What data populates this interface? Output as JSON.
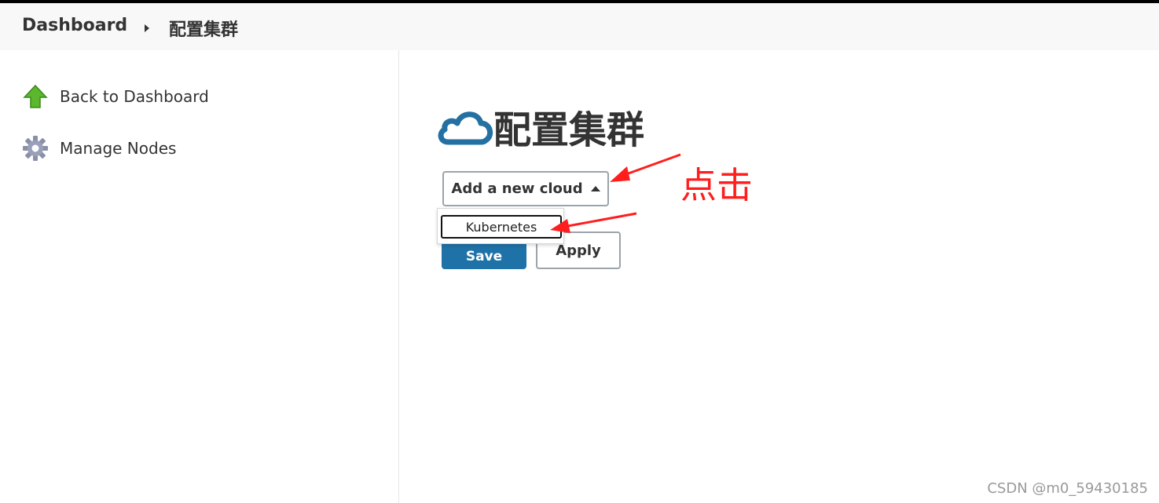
{
  "breadcrumb": {
    "root": "Dashboard",
    "current": "配置集群"
  },
  "sidebar": {
    "items": [
      {
        "label": "Back to Dashboard",
        "icon": "up-arrow-icon"
      },
      {
        "label": "Manage Nodes",
        "icon": "gear-icon"
      }
    ]
  },
  "main": {
    "title": "配置集群",
    "title_icon": "cloud-icon",
    "add_cloud_label": "Add a new cloud",
    "dropdown_options": [
      "Kubernetes"
    ],
    "save_label": "Save",
    "apply_label": "Apply"
  },
  "annotation": {
    "text": "点击",
    "color": "#ff1e1e"
  },
  "watermark": "CSDN @m0_59430185",
  "colors": {
    "primary": "#1f72a8",
    "cloud": "#2470a3",
    "arrow": "#ff1e1e"
  }
}
